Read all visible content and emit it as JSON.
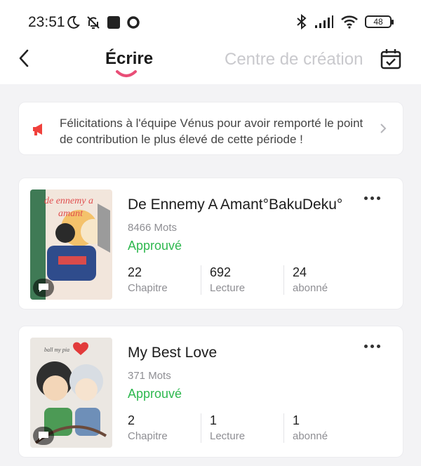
{
  "status_bar": {
    "time": "23:51",
    "battery": "48",
    "icons": [
      "moon-icon",
      "bell-off-icon",
      "square-icon",
      "circle-icon",
      "bluetooth-icon",
      "signal-icon",
      "wifi-icon",
      "battery-icon"
    ]
  },
  "header": {
    "tab_write": "Écrire",
    "tab_center": "Centre de création",
    "accent": "#e94e77"
  },
  "notice": {
    "text": "Félicitations à l'équipe Vénus pour avoir remporté le point de contribution le plus élevé de cette période !",
    "icon_color": "#f0413c"
  },
  "works": [
    {
      "title": "De Ennemy A Amant°BakuDeku°",
      "words": "8466 Mots",
      "status": "Approuvé",
      "stats": [
        {
          "value": "22",
          "label": "Chapitre"
        },
        {
          "value": "692",
          "label": "Lecture"
        },
        {
          "value": "24",
          "label": "abonné"
        }
      ]
    },
    {
      "title": "My Best Love",
      "words": "371 Mots",
      "status": "Approuvé",
      "stats": [
        {
          "value": "2",
          "label": "Chapitre"
        },
        {
          "value": "1",
          "label": "Lecture"
        },
        {
          "value": "1",
          "label": "abonné"
        }
      ]
    }
  ],
  "colors": {
    "approved": "#2eb84f",
    "muted": "#8e8e93"
  }
}
